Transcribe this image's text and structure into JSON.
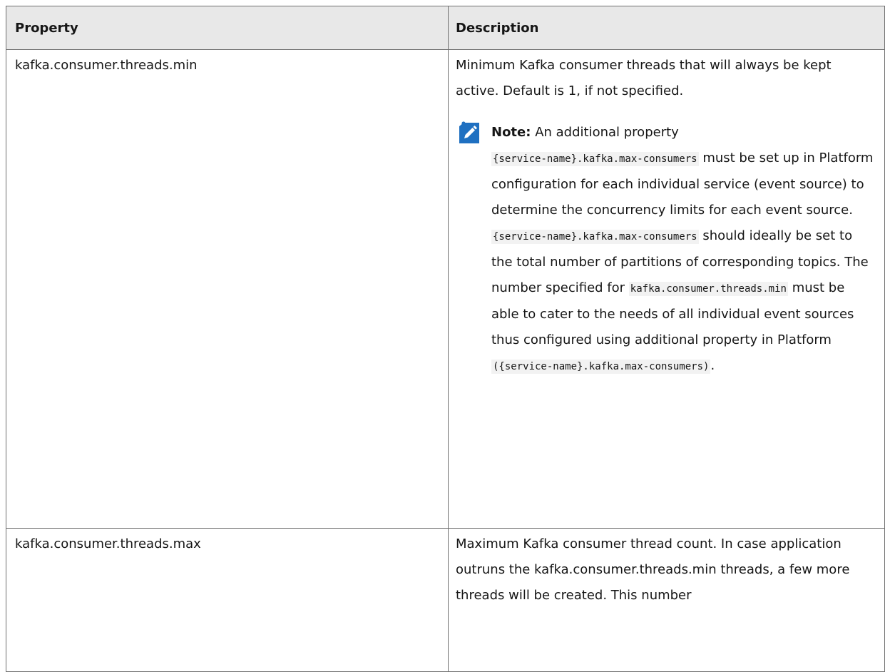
{
  "table": {
    "headers": {
      "property": "Property",
      "description": "Description"
    },
    "rows": [
      {
        "property": "kafka.consumer.threads.min",
        "description": "Minimum Kafka consumer threads that will always be kept active. Default is 1, if not specified.",
        "note": {
          "label": "Note:",
          "intro": "An additional property",
          "code1": "{service-name}.kafka.max-consumers",
          "text1": "must be set up in Platform configuration for each individual service (event source) to determine the concurrency limits for each event source.",
          "code2": "{service-name}.kafka.max-consumers",
          "text2": "should ideally be set to the total number of partitions of corresponding topics. The number specified for",
          "code3": "kafka.consumer.threads.min",
          "text3": "must be able to cater to the needs of all individual event sources thus configured using additional property in Platform",
          "code4": "({service-name}.kafka.max-consumers)",
          "end": "."
        }
      },
      {
        "property": "kafka.consumer.threads.max",
        "description": "Maximum Kafka consumer thread count. In case application outruns the kafka.consumer.threads.min threads, a few more threads will be created. This number"
      }
    ]
  },
  "icons": {
    "note": "pencil-note-icon"
  },
  "colors": {
    "header_bg": "#e8e8e8",
    "border": "#6f6f6f",
    "note_icon": "#1f70c1",
    "text": "#161616"
  }
}
